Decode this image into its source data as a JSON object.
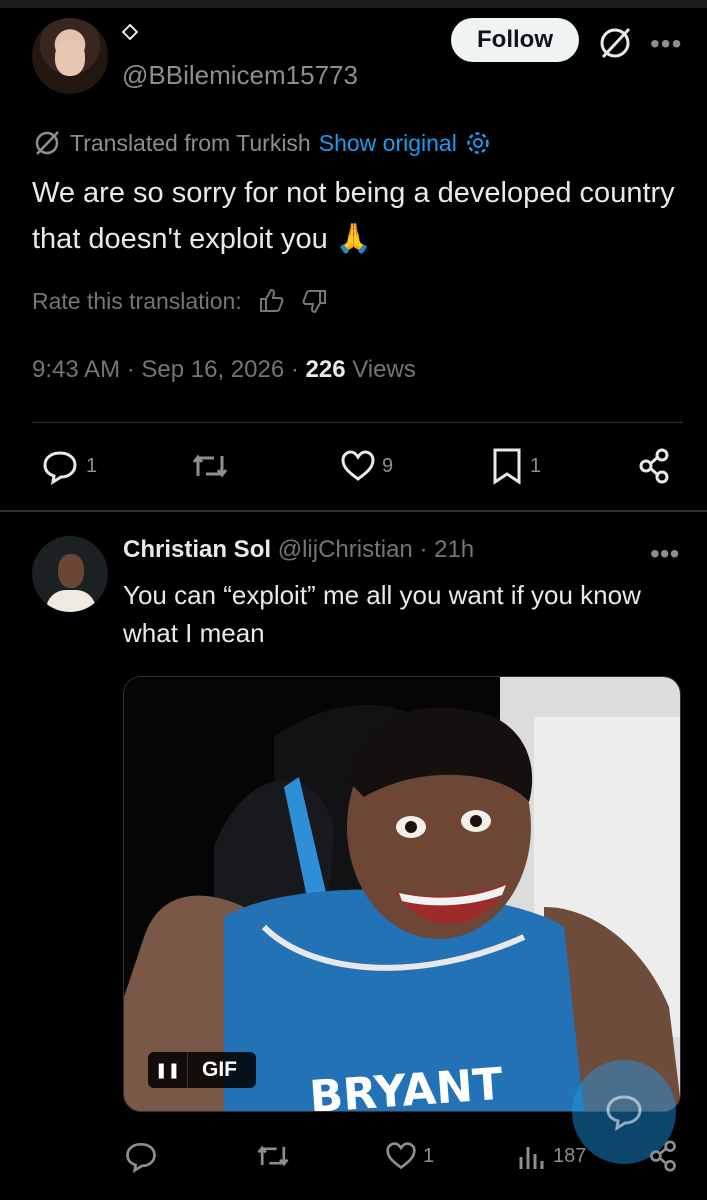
{
  "main_tweet": {
    "handle": "@BBilemicem15773",
    "follow_label": "Follow",
    "translated_label": "Translated from Turkish",
    "show_original_label": "Show original",
    "text": "We are so sorry for not being a developed country that doesn't exploit you 🙏",
    "rate_label": "Rate this translation:",
    "time": "9:43 AM",
    "date": "Sep 16, 2026",
    "views_count": "226",
    "views_label": "Views",
    "replies": "1",
    "likes": "9",
    "bookmarks": "1"
  },
  "reply": {
    "name": "Christian Sol",
    "handle": "@lijChristian",
    "age": "21h",
    "text": "You can “exploit” me all you want if you know what I mean",
    "gif_label": "GIF",
    "gif_jersey_text": "BRYANT",
    "likes": "1",
    "views": "187"
  },
  "colors": {
    "background": "#000000",
    "accent": "#1d9bf0",
    "muted": "#71767b",
    "text": "#e7e9ea"
  }
}
